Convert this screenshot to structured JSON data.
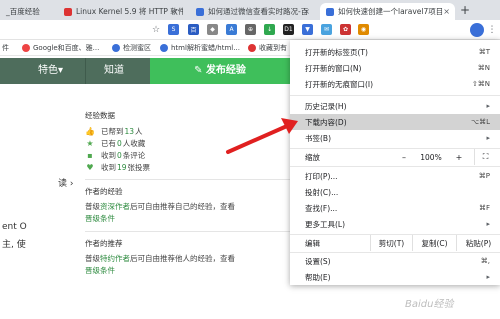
{
  "tabs": [
    {
      "label": "_百度经验",
      "favicon_color": "#3a6fd8",
      "active": false
    },
    {
      "label": "Linux Kernel 5.9 将 HTTP 软件",
      "favicon_color": "#d33",
      "active": false
    },
    {
      "label": "如何通过微信查看实时路况-百",
      "favicon_color": "#3a6fd8",
      "active": false
    },
    {
      "label": "如何快速创建一个laravel7项目",
      "favicon_color": "#3a6fd8",
      "active": true
    }
  ],
  "newtab_label": "+",
  "toolbar": {
    "star_icon": "star-icon",
    "menu_icon": "more-vert-icon",
    "extensions": [
      "S",
      "百",
      "◆",
      "A",
      "⊕",
      "↓",
      "D1",
      "▼",
      "✉",
      "✿",
      "◉"
    ]
  },
  "bookmarks": [
    {
      "label": "件",
      "dot_color": "#888"
    },
    {
      "label": "Google和百度、雅...",
      "dot_color": "#e44"
    },
    {
      "label": "检测蜜区",
      "dot_color": "#3a6fd8"
    },
    {
      "label": "html解析蜜蜡/html...",
      "dot_color": "#3a6fd8"
    },
    {
      "label": "收藏到有",
      "dot_color": "#d33"
    }
  ],
  "nav": {
    "items": [
      "特色▾",
      "知道"
    ],
    "publish_label": "发布经验",
    "publish_icon": "pen-icon"
  },
  "left_fragments": [
    "读 ›",
    "ent O",
    "主, 使"
  ],
  "sidebar": {
    "stats_title": "经验数据",
    "stats": [
      {
        "icon": "thumb-up-icon",
        "prefix": "已帮到",
        "num": "13",
        "suffix": "人"
      },
      {
        "icon": "star-icon",
        "prefix": "已有",
        "num": "0",
        "suffix": "人收藏"
      },
      {
        "icon": "comment-icon",
        "prefix": "收到",
        "num": "0",
        "suffix": "条评论"
      },
      {
        "icon": "like-icon",
        "prefix": "收到",
        "num": "19",
        "suffix": "张投票"
      }
    ],
    "author_exp_title": "作者的经验",
    "author_exp_text_pre": "普级",
    "author_exp_link": "资深作者",
    "author_exp_text_post": "后可自由推荐自己的经验，查看",
    "author_exp_link2": "晋级条件",
    "author_rec_title": "作者的推荐",
    "author_rec_text_pre": "普级",
    "author_rec_link": "特约作者",
    "author_rec_text_post": "后可自由推荐他人的经验，查看",
    "author_rec_link2": "晋级条件"
  },
  "menu": {
    "items": [
      {
        "label": "打开新的标签页(T)",
        "shortcut": "⌘T"
      },
      {
        "label": "打开新的窗口(N)",
        "shortcut": "⌘N"
      },
      {
        "label": "打开新的无痕窗口(I)",
        "shortcut": "⇧⌘N"
      },
      {
        "label": "历史记录(H)",
        "shortcut": "▸"
      },
      {
        "label": "下载内容(D)",
        "shortcut": "⌥⌘L"
      },
      {
        "label": "书签(B)",
        "shortcut": "▸"
      },
      {
        "label": "打印(P)...",
        "shortcut": "⌘P"
      },
      {
        "label": "投射(C)...",
        "shortcut": ""
      },
      {
        "label": "查找(F)...",
        "shortcut": "⌘F"
      },
      {
        "label": "更多工具(L)",
        "shortcut": "▸"
      },
      {
        "label": "设置(S)",
        "shortcut": "⌘,"
      },
      {
        "label": "帮助(E)",
        "shortcut": "▸"
      }
    ],
    "zoom_label": "缩放",
    "zoom_minus": "–",
    "zoom_value": "100%",
    "zoom_plus": "+",
    "fullscreen_icon": "fullscreen-icon",
    "edit_label": "编辑",
    "cut_label": "剪切(T)",
    "copy_label": "复制(C)",
    "paste_label": "粘贴(P)"
  },
  "watermark": "Baidu经验",
  "colors": {
    "nav_green": "#4e6d5c",
    "publish_green": "#3fbf5b",
    "highlight": "#d3d3d3",
    "arrow_red": "#e02020"
  }
}
